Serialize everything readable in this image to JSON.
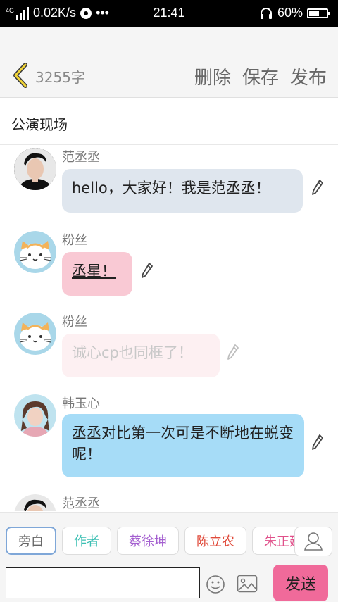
{
  "status_bar": {
    "network_type": "4G",
    "speed": "0.02K/s",
    "more": "•••",
    "time": "21:41",
    "battery": "60%",
    "battery_level": 0.6
  },
  "toolbar": {
    "word_count": "3255字",
    "delete_label": "删除",
    "save_label": "保存",
    "publish_label": "发布"
  },
  "title": "公演现场",
  "messages": [
    {
      "name": "范丞丞",
      "text": "hello，大家好！我是范丞丞！",
      "bubble_color": "#dfe6ee",
      "text_color": "#222222"
    },
    {
      "name": "粉丝",
      "text": "丞星！",
      "bubble_color": "#f9c9d4",
      "text_color": "#222222"
    },
    {
      "name": "粉丝",
      "text": "诚心cp也同框了！",
      "bubble_color": "#fdf0f2",
      "text_color": "#c8c8c8"
    },
    {
      "name": "韩玉心",
      "text": "丞丞对比第一次可是不断地在蜕变呢！",
      "bubble_color": "#a6dcf7",
      "text_color": "#222222"
    },
    {
      "name": "范丞丞",
      "text": "",
      "bubble_color": "",
      "text_color": ""
    }
  ],
  "roles": [
    {
      "label": "旁白",
      "color": "#666666"
    },
    {
      "label": "作者",
      "color": "#3bbfb3"
    },
    {
      "label": "蔡徐坤",
      "color": "#a45fd0"
    },
    {
      "label": "陈立农",
      "color": "#e04a3a"
    },
    {
      "label": "朱正廷",
      "color": "#e0508a"
    }
  ],
  "input": {
    "value": "",
    "placeholder": ""
  },
  "send_label": "发送",
  "colors": {
    "send": "#f06a9a",
    "selected_chip_border": "#7fa7d8"
  }
}
